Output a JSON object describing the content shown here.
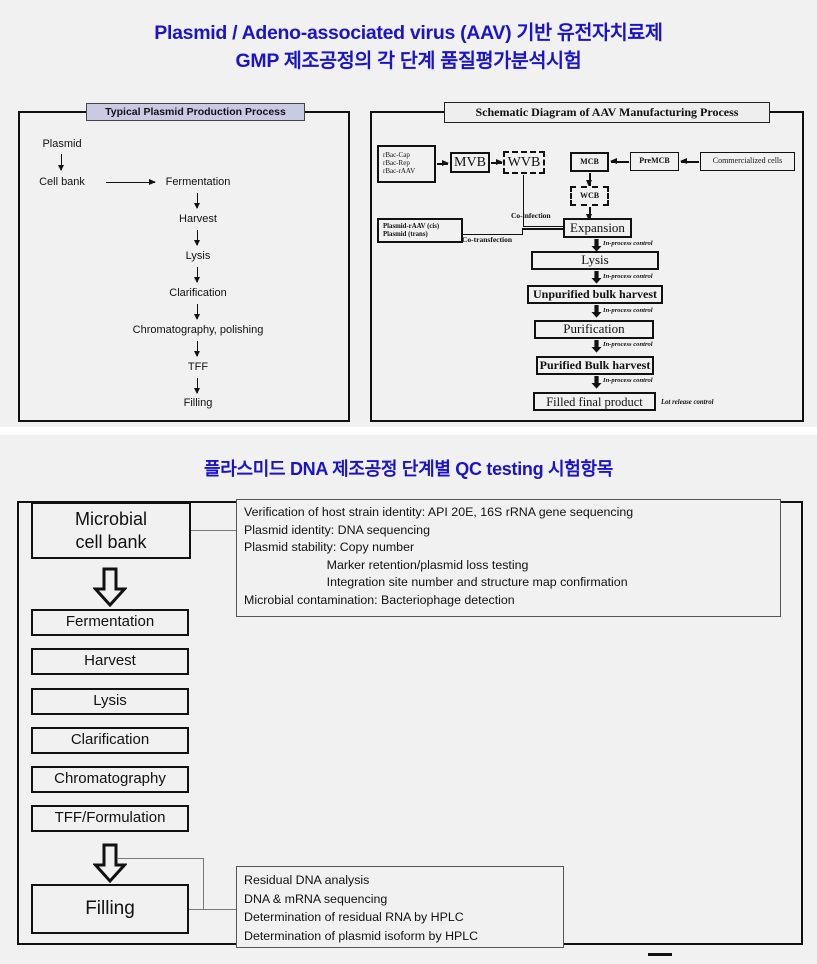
{
  "colors": {
    "title_blue": "#1a14c8",
    "page_bg": "#f1f1f1",
    "panel_title_bg": "#c9cbe3",
    "ink": "#111111"
  },
  "header": {
    "title_line1": "Plasmid / Adeno-associated virus (AAV) 기반 유전자치료제",
    "title_line2": "GMP 제조공정의 각 단계 품질평가분석시험"
  },
  "top_left_panel": {
    "title": "Typical Plasmid Production Process",
    "start_node": "Plasmid",
    "steps": [
      "Cell bank",
      "Fermentation",
      "Harvest",
      "Lysis",
      "Clarification",
      "Chromatography, polishing",
      "TFF",
      "Filling"
    ]
  },
  "top_right_panel": {
    "title": "Schematic Diagram of AAV Manufacturing Process",
    "baculovirus_inputs": [
      "rBac-Cap",
      "rBac-Rep",
      "rBac-rAAV"
    ],
    "plasmid_inputs": [
      "Plasmid-rAAV (cis)",
      "Plasmid (trans)"
    ],
    "banks": {
      "mvb": "MVB",
      "wvb": "WVB",
      "mcb": "MCB",
      "wcb": "WCB",
      "premcb": "PreMCB",
      "commercialized_cells": "Commercialized  cells"
    },
    "route_labels": {
      "co_infection": "Co-infection",
      "co_transfection": "Co-transfection"
    },
    "process_steps": [
      "Expansion",
      "Lysis",
      "Unpurified bulk harvest",
      "Purification",
      "Purified Bulk harvest",
      "Filled final product"
    ],
    "control_labels": {
      "in_process": "In-process control",
      "lot_release": "Lot release control"
    }
  },
  "bottom_section": {
    "subtitle": "플라스미드 DNA 제조공정 단계별 QC testing 시험항목",
    "start_box": "Microbial\ncell bank",
    "start_box_line1": "Microbial",
    "start_box_line2": "cell bank",
    "steps": [
      "Fermentation",
      "Harvest",
      "Lysis",
      "Clarification",
      "Chromatography",
      "TFF/Formulation"
    ],
    "end_box": "Filling",
    "note_cell_bank": "Verification of host strain identity: API 20E, 16S rRNA gene sequencing\nPlasmid identity: DNA sequencing\nPlasmid stability: Copy number\n                        Marker retention/plasmid loss testing\n                        Integration site number and structure map confirmation\nMicrobial contamination: Bacteriophage detection",
    "note_filling": "Residual DNA analysis\nDNA & mRNA sequencing\nDetermination of residual RNA by HPLC\nDetermination of plasmid isoform by HPLC"
  }
}
